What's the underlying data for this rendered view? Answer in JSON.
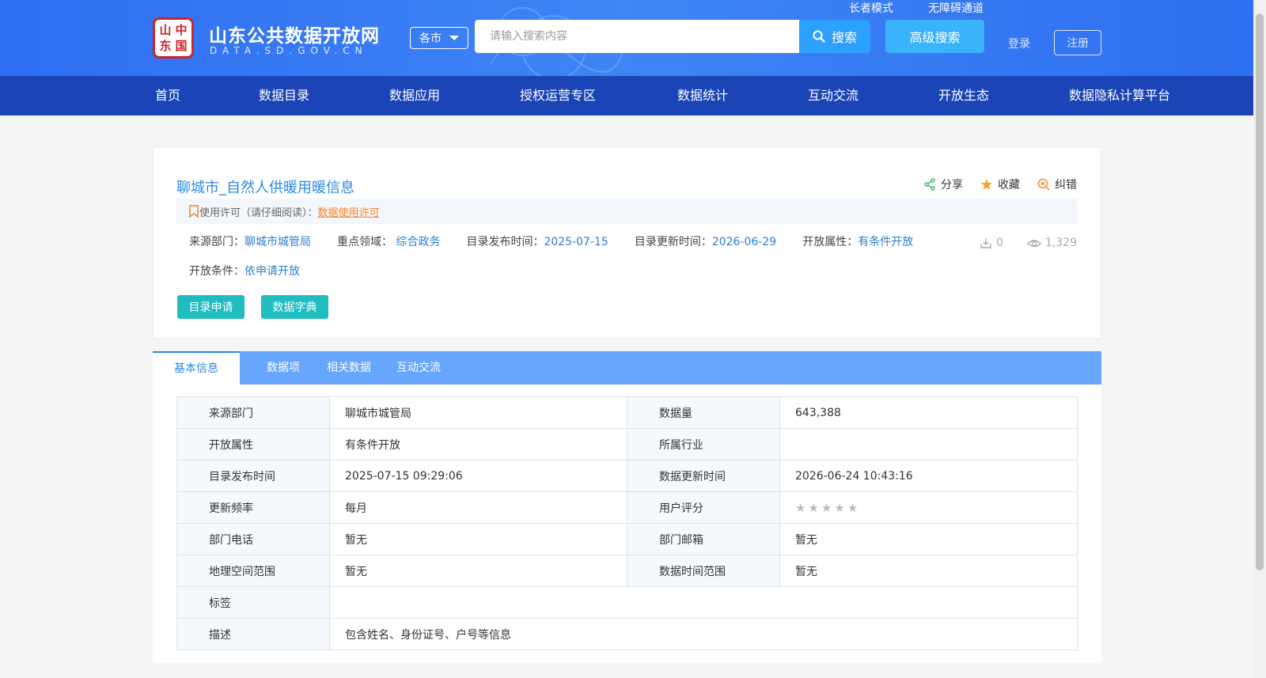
{
  "header": {
    "logo_seal_chars": [
      "山",
      "中",
      "东",
      "国"
    ],
    "site_title": "山东公共数据开放网",
    "site_subtitle": "DATA.SD.GOV.CN",
    "city_select": "各市",
    "search_placeholder": "请输入搜索内容",
    "search_label": "搜索",
    "advanced_search_label": "高级搜索",
    "elder_mode": "长者模式",
    "accessibility": "无障碍通道",
    "login": "登录",
    "register": "注册"
  },
  "nav": [
    "首页",
    "数据目录",
    "数据应用",
    "授权运营专区",
    "数据统计",
    "互动交流",
    "开放生态",
    "数据隐私计算平台"
  ],
  "dataset": {
    "title": "聊城市_自然人供暖用暖信息",
    "actions": {
      "share": "分享",
      "favorite": "收藏",
      "correct": "纠错"
    },
    "license_prefix": "使用许可（请仔细阅读）：",
    "license_link": "数据使用许可",
    "meta": {
      "source_label": "来源部门：",
      "source_value": "聊城市城管局",
      "field_label": "重点领域：",
      "field_value": "综合政务",
      "publish_label": "目录发布时间：",
      "publish_value": "2025-07-15",
      "update_label": "目录更新时间：",
      "update_value": "2026-06-29",
      "open_label": "开放属性：",
      "open_value": "有条件开放",
      "condition_label": "开放条件：",
      "condition_value": "依申请开放"
    },
    "downloads": "0",
    "views": "1,329",
    "apply_button": "目录申请",
    "dictionary_button": "数据字典"
  },
  "tabs": [
    "基本信息",
    "数据项",
    "相关数据",
    "互动交流"
  ],
  "info_table": {
    "source_dept_k": "来源部门",
    "source_dept_v": "聊城市城管局",
    "data_volume_k": "数据量",
    "data_volume_v": "643,388",
    "open_attr_k": "开放属性",
    "open_attr_v": "有条件开放",
    "industry_k": "所属行业",
    "industry_v": "",
    "publish_time_k": "目录发布时间",
    "publish_time_v": "2025-07-15 09:29:06",
    "data_update_k": "数据更新时间",
    "data_update_v": "2026-06-24 10:43:16",
    "freq_k": "更新频率",
    "freq_v": "每月",
    "rating_k": "用户评分",
    "rating_v": 0,
    "phone_k": "部门电话",
    "phone_v": "暂无",
    "email_k": "部门邮箱",
    "email_v": "暂无",
    "geo_k": "地理空间范围",
    "geo_v": "暂无",
    "time_range_k": "数据时间范围",
    "time_range_v": "暂无",
    "tags_k": "标签",
    "tags_v": "",
    "desc_k": "描述",
    "desc_v": "包含姓名、身份证号、户号等信息"
  },
  "colors": {
    "header_blue": "#3f85f5",
    "nav_blue": "#1b44b6",
    "link_blue": "#2b89e8",
    "teal": "#1fbdbf",
    "orange": "#f0862e"
  }
}
